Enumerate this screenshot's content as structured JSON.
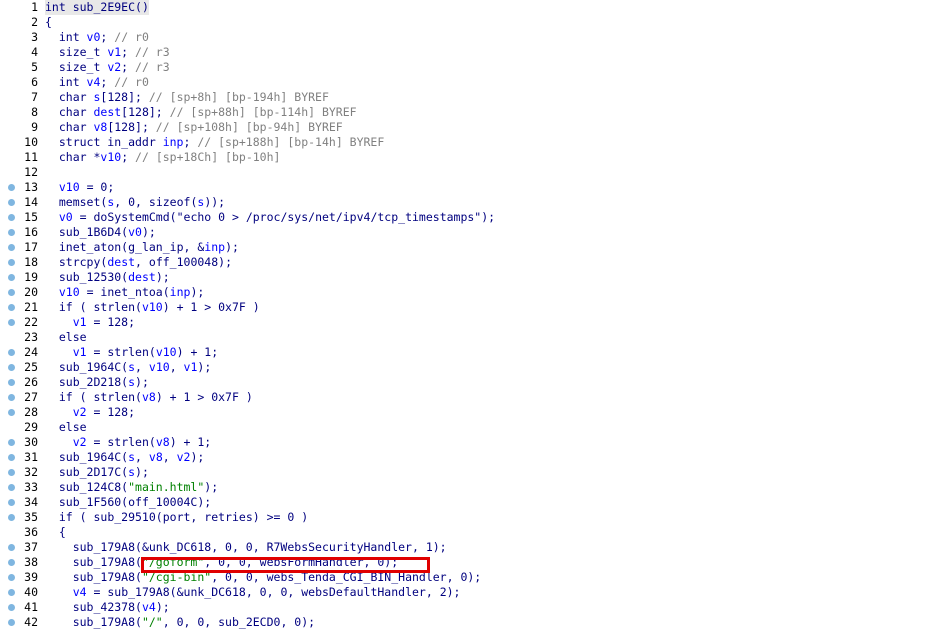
{
  "colors": {
    "keyword": "#00007f",
    "identifier": "#00007f",
    "variable": "#0000ff",
    "comment": "#808080",
    "string": "#008000",
    "number": "#008000",
    "highlight_bg": "#e8e8e8",
    "annotation": "#e00000",
    "breakpoint_dot": "#7fb6e0"
  },
  "lines": [
    {
      "n": "1",
      "dot": false,
      "hl": true,
      "t": [
        [
          "kw",
          "int "
        ],
        [
          "id",
          "sub_2E9EC"
        ],
        [
          "p",
          "()"
        ]
      ]
    },
    {
      "n": "2",
      "dot": false,
      "t": [
        [
          "p",
          "{"
        ]
      ]
    },
    {
      "n": "3",
      "dot": false,
      "t": [
        [
          "kw",
          "  int "
        ],
        [
          "var",
          "v0"
        ],
        [
          "p",
          "; "
        ],
        [
          "cm",
          "// r0"
        ]
      ]
    },
    {
      "n": "4",
      "dot": false,
      "t": [
        [
          "kw",
          "  size_t "
        ],
        [
          "var",
          "v1"
        ],
        [
          "p",
          "; "
        ],
        [
          "cm",
          "// r3"
        ]
      ]
    },
    {
      "n": "5",
      "dot": false,
      "t": [
        [
          "kw",
          "  size_t "
        ],
        [
          "var",
          "v2"
        ],
        [
          "p",
          "; "
        ],
        [
          "cm",
          "// r3"
        ]
      ]
    },
    {
      "n": "6",
      "dot": false,
      "t": [
        [
          "kw",
          "  int "
        ],
        [
          "var",
          "v4"
        ],
        [
          "p",
          "; "
        ],
        [
          "cm",
          "// r0"
        ]
      ]
    },
    {
      "n": "7",
      "dot": false,
      "t": [
        [
          "kw",
          "  char "
        ],
        [
          "var",
          "s"
        ],
        [
          "p",
          "[128]; "
        ],
        [
          "cm",
          "// [sp+8h] [bp-194h] BYREF"
        ]
      ]
    },
    {
      "n": "8",
      "dot": false,
      "t": [
        [
          "kw",
          "  char "
        ],
        [
          "var",
          "dest"
        ],
        [
          "p",
          "[128]; "
        ],
        [
          "cm",
          "// [sp+88h] [bp-114h] BYREF"
        ]
      ]
    },
    {
      "n": "9",
      "dot": false,
      "t": [
        [
          "kw",
          "  char "
        ],
        [
          "var",
          "v8"
        ],
        [
          "p",
          "[128]; "
        ],
        [
          "cm",
          "// [sp+108h] [bp-94h] BYREF"
        ]
      ]
    },
    {
      "n": "10",
      "dot": false,
      "t": [
        [
          "kw",
          "  struct in_addr "
        ],
        [
          "var",
          "inp"
        ],
        [
          "p",
          "; "
        ],
        [
          "cm",
          "// [sp+188h] [bp-14h] BYREF"
        ]
      ]
    },
    {
      "n": "11",
      "dot": false,
      "t": [
        [
          "kw",
          "  char "
        ],
        [
          "p",
          "*"
        ],
        [
          "var",
          "v10"
        ],
        [
          "p",
          "; "
        ],
        [
          "cm",
          "// [sp+18Ch] [bp-10h]"
        ]
      ]
    },
    {
      "n": "12",
      "dot": false,
      "t": []
    },
    {
      "n": "13",
      "dot": true,
      "t": [
        [
          "p",
          "  "
        ],
        [
          "var",
          "v10"
        ],
        [
          "p",
          " = 0;"
        ]
      ]
    },
    {
      "n": "14",
      "dot": true,
      "t": [
        [
          "p",
          "  "
        ],
        [
          "id",
          "memset"
        ],
        [
          "p",
          "("
        ],
        [
          "var",
          "s"
        ],
        [
          "p",
          ", 0, sizeof("
        ],
        [
          "var",
          "s"
        ],
        [
          "p",
          "));"
        ]
      ]
    },
    {
      "n": "15",
      "dot": true,
      "t": [
        [
          "p",
          "  "
        ],
        [
          "var",
          "v0"
        ],
        [
          "p",
          " = "
        ],
        [
          "id",
          "doSystemCmd"
        ],
        [
          "p",
          "(\"echo 0 > /proc/sys/net/ipv4/tcp_timestamps\");"
        ]
      ]
    },
    {
      "n": "16",
      "dot": true,
      "t": [
        [
          "p",
          "  "
        ],
        [
          "id",
          "sub_1B6D4"
        ],
        [
          "p",
          "("
        ],
        [
          "var",
          "v0"
        ],
        [
          "p",
          ");"
        ]
      ]
    },
    {
      "n": "17",
      "dot": true,
      "t": [
        [
          "p",
          "  "
        ],
        [
          "id",
          "inet_aton"
        ],
        [
          "p",
          "("
        ],
        [
          "id",
          "g_lan_ip"
        ],
        [
          "p",
          ", &"
        ],
        [
          "var",
          "inp"
        ],
        [
          "p",
          ");"
        ]
      ]
    },
    {
      "n": "18",
      "dot": true,
      "t": [
        [
          "p",
          "  "
        ],
        [
          "id",
          "strcpy"
        ],
        [
          "p",
          "("
        ],
        [
          "var",
          "dest"
        ],
        [
          "p",
          ", "
        ],
        [
          "id",
          "off_100048"
        ],
        [
          "p",
          ");"
        ]
      ]
    },
    {
      "n": "19",
      "dot": true,
      "t": [
        [
          "p",
          "  "
        ],
        [
          "id",
          "sub_12530"
        ],
        [
          "p",
          "("
        ],
        [
          "var",
          "dest"
        ],
        [
          "p",
          ");"
        ]
      ]
    },
    {
      "n": "20",
      "dot": true,
      "t": [
        [
          "p",
          "  "
        ],
        [
          "var",
          "v10"
        ],
        [
          "p",
          " = "
        ],
        [
          "id",
          "inet_ntoa"
        ],
        [
          "p",
          "("
        ],
        [
          "var",
          "inp"
        ],
        [
          "p",
          ");"
        ]
      ]
    },
    {
      "n": "21",
      "dot": true,
      "t": [
        [
          "p",
          "  if ( "
        ],
        [
          "id",
          "strlen"
        ],
        [
          "p",
          "("
        ],
        [
          "var",
          "v10"
        ],
        [
          "p",
          ") + 1 > 0x7F )"
        ]
      ]
    },
    {
      "n": "22",
      "dot": true,
      "t": [
        [
          "p",
          "    "
        ],
        [
          "var",
          "v1"
        ],
        [
          "p",
          " = 128;"
        ]
      ]
    },
    {
      "n": "23",
      "dot": false,
      "t": [
        [
          "p",
          "  else"
        ]
      ]
    },
    {
      "n": "24",
      "dot": true,
      "t": [
        [
          "p",
          "    "
        ],
        [
          "var",
          "v1"
        ],
        [
          "p",
          " = "
        ],
        [
          "id",
          "strlen"
        ],
        [
          "p",
          "("
        ],
        [
          "var",
          "v10"
        ],
        [
          "p",
          ") + 1;"
        ]
      ]
    },
    {
      "n": "25",
      "dot": true,
      "t": [
        [
          "p",
          "  "
        ],
        [
          "id",
          "sub_1964C"
        ],
        [
          "p",
          "("
        ],
        [
          "var",
          "s"
        ],
        [
          "p",
          ", "
        ],
        [
          "var",
          "v10"
        ],
        [
          "p",
          ", "
        ],
        [
          "var",
          "v1"
        ],
        [
          "p",
          ");"
        ]
      ]
    },
    {
      "n": "26",
      "dot": true,
      "t": [
        [
          "p",
          "  "
        ],
        [
          "id",
          "sub_2D218"
        ],
        [
          "p",
          "("
        ],
        [
          "var",
          "s"
        ],
        [
          "p",
          ");"
        ]
      ]
    },
    {
      "n": "27",
      "dot": true,
      "t": [
        [
          "p",
          "  if ( "
        ],
        [
          "id",
          "strlen"
        ],
        [
          "p",
          "("
        ],
        [
          "var",
          "v8"
        ],
        [
          "p",
          ") + 1 > 0x7F )"
        ]
      ]
    },
    {
      "n": "28",
      "dot": true,
      "t": [
        [
          "p",
          "    "
        ],
        [
          "var",
          "v2"
        ],
        [
          "p",
          " = 128;"
        ]
      ]
    },
    {
      "n": "29",
      "dot": false,
      "t": [
        [
          "p",
          "  else"
        ]
      ]
    },
    {
      "n": "30",
      "dot": true,
      "t": [
        [
          "p",
          "    "
        ],
        [
          "var",
          "v2"
        ],
        [
          "p",
          " = "
        ],
        [
          "id",
          "strlen"
        ],
        [
          "p",
          "("
        ],
        [
          "var",
          "v8"
        ],
        [
          "p",
          ") + 1;"
        ]
      ]
    },
    {
      "n": "31",
      "dot": true,
      "t": [
        [
          "p",
          "  "
        ],
        [
          "id",
          "sub_1964C"
        ],
        [
          "p",
          "("
        ],
        [
          "var",
          "s"
        ],
        [
          "p",
          ", "
        ],
        [
          "var",
          "v8"
        ],
        [
          "p",
          ", "
        ],
        [
          "var",
          "v2"
        ],
        [
          "p",
          ");"
        ]
      ]
    },
    {
      "n": "32",
      "dot": true,
      "t": [
        [
          "p",
          "  "
        ],
        [
          "id",
          "sub_2D17C"
        ],
        [
          "p",
          "("
        ],
        [
          "var",
          "s"
        ],
        [
          "p",
          ");"
        ]
      ]
    },
    {
      "n": "33",
      "dot": true,
      "t": [
        [
          "p",
          "  "
        ],
        [
          "id",
          "sub_124C8"
        ],
        [
          "p",
          "("
        ],
        [
          "str",
          "\"main.html\""
        ],
        [
          "p",
          ");"
        ]
      ]
    },
    {
      "n": "34",
      "dot": true,
      "t": [
        [
          "p",
          "  "
        ],
        [
          "id",
          "sub_1F560"
        ],
        [
          "p",
          "("
        ],
        [
          "id",
          "off_10004C"
        ],
        [
          "p",
          ");"
        ]
      ]
    },
    {
      "n": "35",
      "dot": true,
      "t": [
        [
          "p",
          "  if ( "
        ],
        [
          "id",
          "sub_29510"
        ],
        [
          "p",
          "("
        ],
        [
          "id",
          "port"
        ],
        [
          "p",
          ", "
        ],
        [
          "id",
          "retries"
        ],
        [
          "p",
          ") >= 0 )"
        ]
      ]
    },
    {
      "n": "36",
      "dot": false,
      "t": [
        [
          "p",
          "  {"
        ]
      ]
    },
    {
      "n": "37",
      "dot": true,
      "t": [
        [
          "p",
          "    "
        ],
        [
          "id",
          "sub_179A8"
        ],
        [
          "p",
          "(&"
        ],
        [
          "id",
          "unk_DC618"
        ],
        [
          "p",
          ", 0, 0, "
        ],
        [
          "id",
          "R7WebsSecurityHandler"
        ],
        [
          "p",
          ", 1);"
        ]
      ]
    },
    {
      "n": "38",
      "dot": true,
      "t": [
        [
          "p",
          "    "
        ],
        [
          "id",
          "sub_179A8"
        ],
        [
          "p",
          "("
        ],
        [
          "str",
          "\"/goform\""
        ],
        [
          "p",
          ", 0, 0, "
        ],
        [
          "id",
          "websFormHandler"
        ],
        [
          "p",
          ", 0);"
        ]
      ]
    },
    {
      "n": "39",
      "dot": true,
      "t": [
        [
          "p",
          "    "
        ],
        [
          "id",
          "sub_179A8"
        ],
        [
          "p",
          "("
        ],
        [
          "str",
          "\"/cgi-bin\""
        ],
        [
          "p",
          ", 0, 0, "
        ],
        [
          "id",
          "webs_Tenda_CGI_BIN_Handler"
        ],
        [
          "p",
          ", 0);"
        ]
      ]
    },
    {
      "n": "40",
      "dot": true,
      "t": [
        [
          "p",
          "    "
        ],
        [
          "var",
          "v4"
        ],
        [
          "p",
          " = "
        ],
        [
          "id",
          "sub_179A8"
        ],
        [
          "p",
          "(&"
        ],
        [
          "id",
          "unk_DC618"
        ],
        [
          "p",
          ", 0, 0, "
        ],
        [
          "id",
          "websDefaultHandler"
        ],
        [
          "p",
          ", 2);"
        ]
      ]
    },
    {
      "n": "41",
      "dot": true,
      "t": [
        [
          "p",
          "    "
        ],
        [
          "id",
          "sub_42378"
        ],
        [
          "p",
          "("
        ],
        [
          "var",
          "v4"
        ],
        [
          "p",
          ");"
        ]
      ]
    },
    {
      "n": "42",
      "dot": true,
      "t": [
        [
          "p",
          "    "
        ],
        [
          "id",
          "sub_179A8"
        ],
        [
          "p",
          "("
        ],
        [
          "str",
          "\"/\""
        ],
        [
          "p",
          ", 0, 0, "
        ],
        [
          "id",
          "sub_2ECD0"
        ],
        [
          "p",
          ", 0);"
        ]
      ]
    }
  ]
}
